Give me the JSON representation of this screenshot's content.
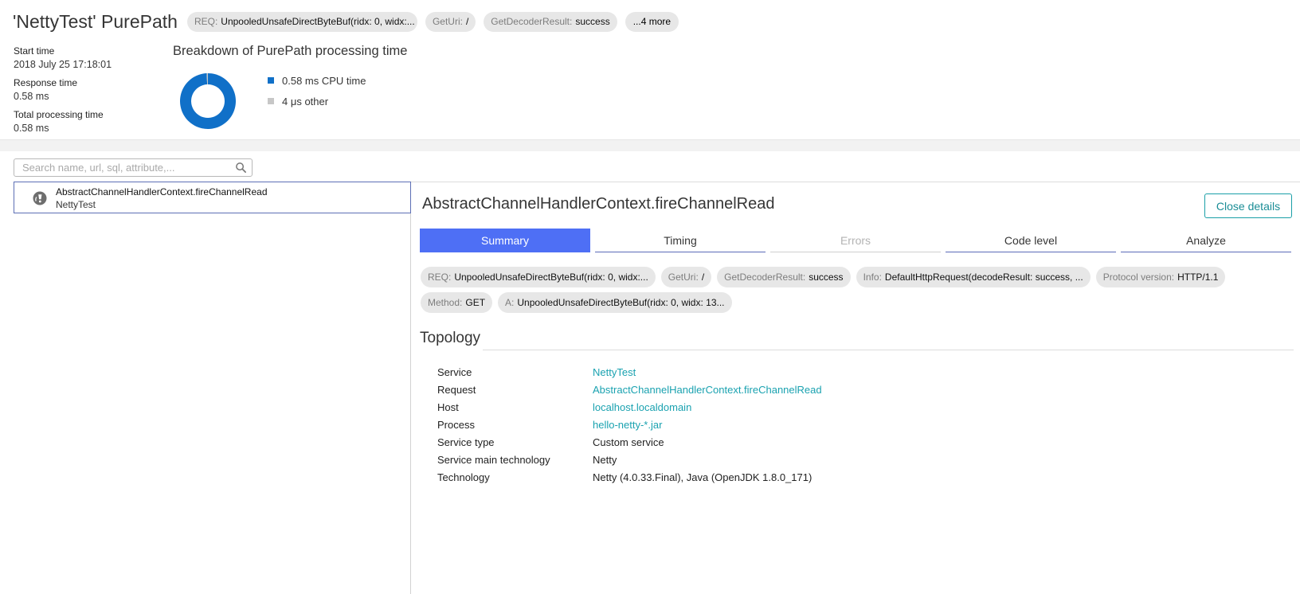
{
  "header": {
    "title": "'NettyTest' PurePath",
    "chips": [
      {
        "key": "REQ:",
        "value": "UnpooledUnsafeDirectByteBuf(ridx: 0, widx:..."
      },
      {
        "key": "GetUri:",
        "value": "/"
      },
      {
        "key": "GetDecoderResult:",
        "value": "success"
      }
    ],
    "more_label": "...4 more",
    "start_time_label": "Start time",
    "start_time_value": "2018 July 25 17:18:01",
    "response_time_label": "Response time",
    "response_time_value": "0.58 ms",
    "total_time_label": "Total processing time",
    "total_time_value": "0.58 ms"
  },
  "breakdown": {
    "title": "Breakdown of PurePath processing time",
    "items": [
      {
        "label": "0.58 ms CPU time",
        "color": "#1070c8",
        "value_ms": 0.58
      },
      {
        "label": "4 μs other",
        "color": "#c7c7c7",
        "value_ms": 0.004
      }
    ]
  },
  "search": {
    "placeholder": "Search name, url, sql, attribute,..."
  },
  "tree": {
    "items": [
      {
        "name": "AbstractChannelHandlerContext.fireChannelRead",
        "service": "NettyTest"
      }
    ]
  },
  "detail": {
    "title": "AbstractChannelHandlerContext.fireChannelRead",
    "close_label": "Close details",
    "tabs": [
      {
        "label": "Summary",
        "state": "active"
      },
      {
        "label": "Timing",
        "state": "normal"
      },
      {
        "label": "Errors",
        "state": "disabled"
      },
      {
        "label": "Code level",
        "state": "normal"
      },
      {
        "label": "Analyze",
        "state": "normal"
      }
    ],
    "attributes_row1": [
      {
        "key": "REQ:",
        "value": "UnpooledUnsafeDirectByteBuf(ridx: 0, widx:..."
      },
      {
        "key": "GetUri:",
        "value": "/"
      },
      {
        "key": "GetDecoderResult:",
        "value": "success"
      },
      {
        "key": "Info:",
        "value": "DefaultHttpRequest(decodeResult: success, ..."
      },
      {
        "key": "Protocol version:",
        "value": "HTTP/1.1"
      }
    ],
    "attributes_row2": [
      {
        "key": "Method:",
        "value": "GET"
      },
      {
        "key": "A:",
        "value": "UnpooledUnsafeDirectByteBuf(ridx: 0, widx: 13..."
      }
    ],
    "topology_title": "Topology",
    "topology": [
      {
        "key": "Service",
        "value": "NettyTest",
        "link": true
      },
      {
        "key": "Request",
        "value": "AbstractChannelHandlerContext.fireChannelRead",
        "link": true
      },
      {
        "key": "Host",
        "value": "localhost.localdomain",
        "link": true
      },
      {
        "key": "Process",
        "value": "hello-netty-*.jar",
        "link": true
      },
      {
        "key": "Service type",
        "value": "Custom service",
        "link": false
      },
      {
        "key": "Service main technology",
        "value": "Netty",
        "link": false
      },
      {
        "key": "Technology",
        "value": "Netty (4.0.33.Final), Java (OpenJDK 1.8.0_171)",
        "link": false
      }
    ]
  }
}
